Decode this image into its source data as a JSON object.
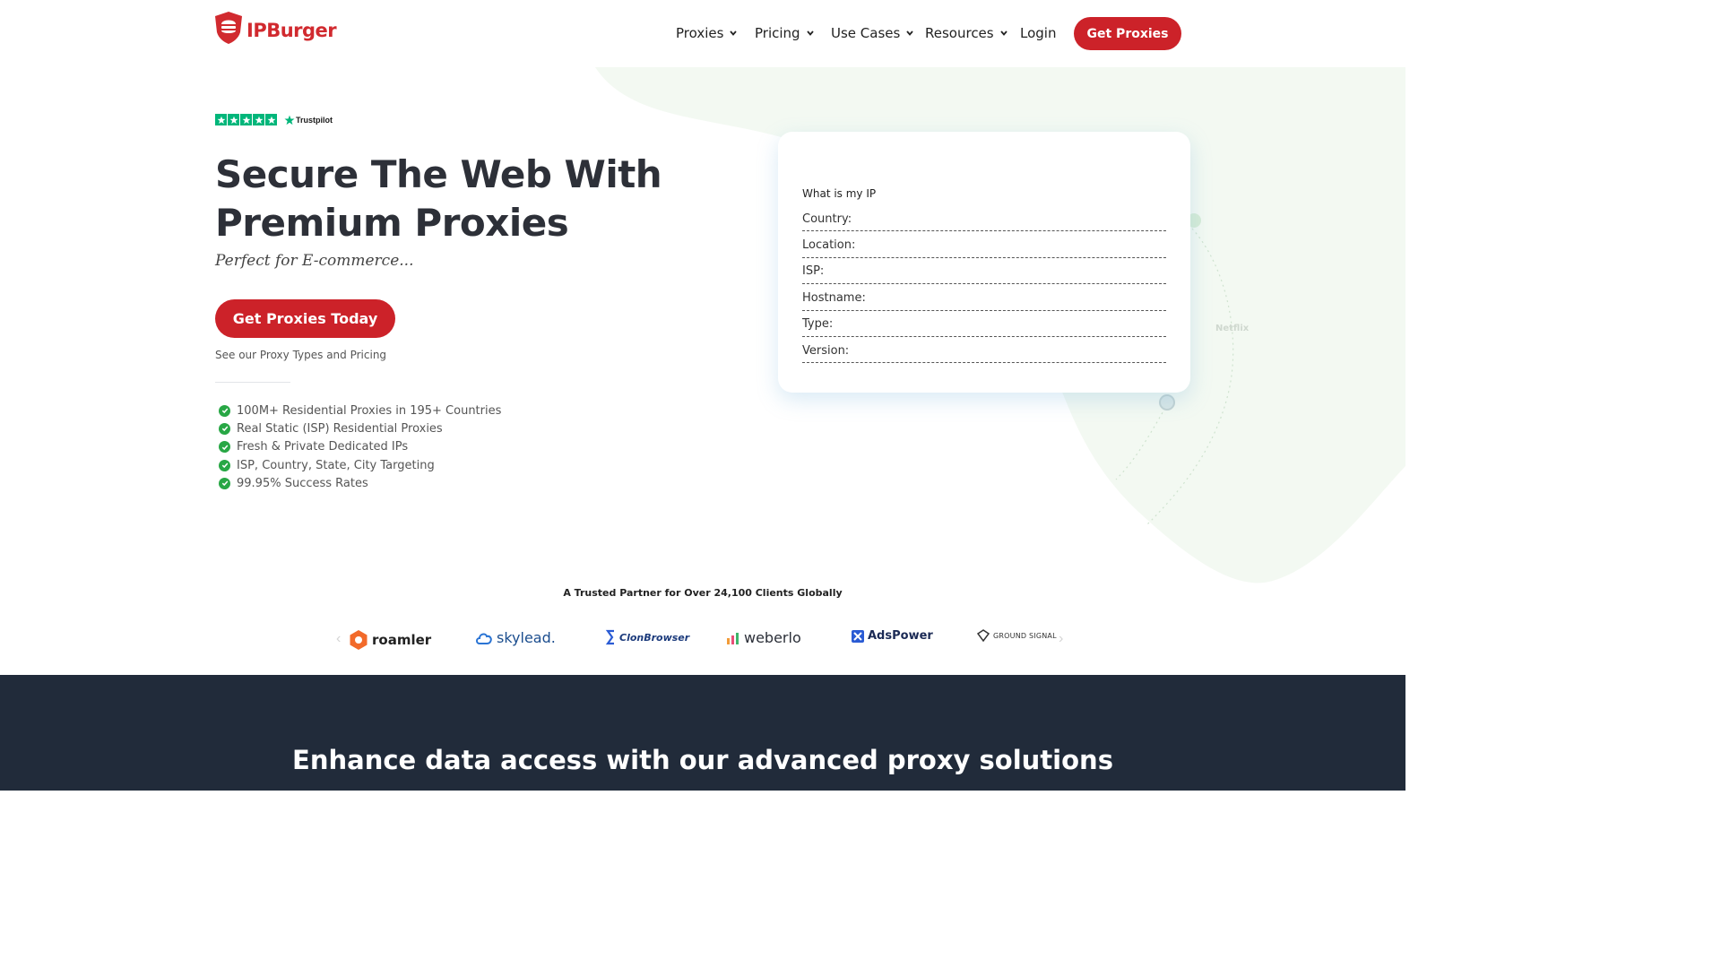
{
  "header": {
    "logo_text": "IPBurger",
    "nav": [
      {
        "label": "Proxies"
      },
      {
        "label": "Pricing"
      },
      {
        "label": "Use Cases"
      },
      {
        "label": "Resources"
      }
    ],
    "login_label": "Login",
    "cta_label": "Get Proxies"
  },
  "hero": {
    "trustpilot_label": "Trustpilot",
    "trustpilot_rating_stars": 5,
    "title": "Secure The Web With Premium Proxies",
    "subtitle": "Perfect for E-commerce...",
    "cta_label": "Get Proxies Today",
    "secondary_link": "See our Proxy Types and Pricing",
    "features": [
      "100M+ Residential Proxies in 195+ Countries",
      "Real Static (ISP) Residential Proxies",
      "Fresh & Private Dedicated IPs",
      "ISP, Country, State, City Targeting",
      "99.95% Success Rates"
    ]
  },
  "ip_card": {
    "title": "What is my IP",
    "rows": [
      "Country:",
      "Location:",
      "ISP:",
      "Hostname:",
      "Type:",
      "Version:"
    ]
  },
  "decor": {
    "side_label": "Netflix"
  },
  "trust": {
    "title": "A Trusted Partner for Over 24,100 Clients Globally",
    "brands": [
      "roamler",
      "skylead.",
      "ClonBrowser",
      "weberlo",
      "AdsPower",
      "GROUND SIGNAL"
    ],
    "prev_arrow": "‹",
    "next_arrow": "›"
  },
  "dark": {
    "title": "Enhance data access with our advanced proxy solutions"
  },
  "colors": {
    "brand_red": "#cc2229",
    "trustpilot_green": "#00b67a",
    "check_green": "#28a745",
    "dark_bg": "#212b3a"
  }
}
